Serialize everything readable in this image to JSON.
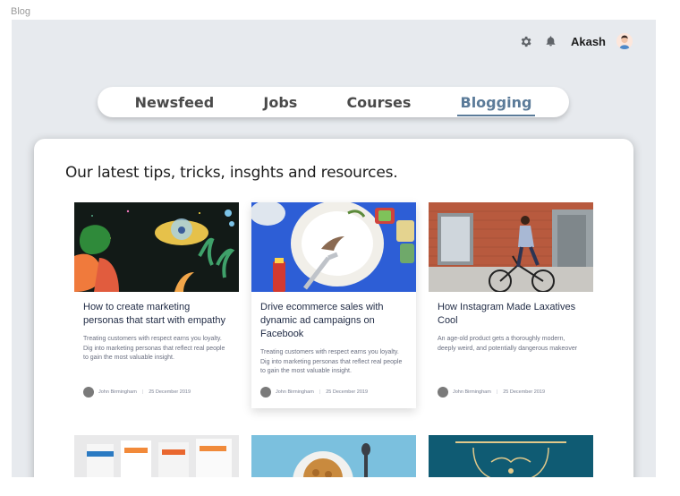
{
  "frame_label": "Blog",
  "user": {
    "name": "Akash"
  },
  "nav": {
    "tabs": [
      "Newsfeed",
      "Jobs",
      "Courses",
      "Blogging"
    ],
    "active": "Blogging"
  },
  "heading": "Our latest tips, tricks, insghts and resources.",
  "cards": [
    {
      "title": "How to create marketing personas that start with empathy",
      "description": "Treating customers with respect earns you loyalty. Dig into marketing personas that reflect real people to gain the most valuable insight.",
      "author": "John Birmingham",
      "date": "25 December 2019"
    },
    {
      "title": "Drive ecommerce sales with dynamic ad campaigns on Facebook",
      "description": "Treating customers with respect earns you loyalty. Dig into marketing personas that reflect real people to gain the most valuable insight.",
      "author": "John Birmingham",
      "date": "25 December 2019"
    },
    {
      "title": "How Instagram Made Laxatives Cool",
      "description": "An age-old product gets a thoroughly modern, deeply weird, and potentially dangerous makeover",
      "author": "John Birmingham",
      "date": "25 December 2019"
    }
  ],
  "colors": {
    "accent": "#5b7b99",
    "canvas": "#e7eaee"
  }
}
